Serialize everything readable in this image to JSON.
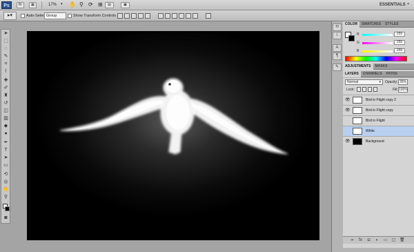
{
  "appbar": {
    "logo": "Ps",
    "zoom": "17%",
    "workspace": "ESSENTIALS"
  },
  "options": {
    "auto_select_label": "Auto-Select:",
    "auto_select_value": "Group",
    "show_transform_label": "Show Transform Controls"
  },
  "color_panel": {
    "tabs": [
      "COLOR",
      "SWATCHES",
      "STYLES"
    ],
    "channels": [
      {
        "name": "R",
        "value": "255"
      },
      {
        "name": "G",
        "value": "255"
      },
      {
        "name": "B",
        "value": "255"
      }
    ]
  },
  "adjustments_panel": {
    "tabs": [
      "ADJUSTMENTS",
      "MASKS"
    ]
  },
  "layers_panel": {
    "tabs": [
      "LAYERS",
      "CHANNELS",
      "PATHS"
    ],
    "blend_mode": "Normal",
    "opacity_label": "Opacity:",
    "opacity_value": "26%",
    "lock_label": "Lock:",
    "fill_label": "Fill:",
    "fill_value": "100%",
    "layers": [
      {
        "name": "Bird in Flight copy 2",
        "visible": true,
        "thumb": "bird",
        "selected": false
      },
      {
        "name": "Bird in Flight copy",
        "visible": true,
        "thumb": "bird",
        "selected": false
      },
      {
        "name": "Bird in Flight",
        "visible": false,
        "thumb": "bird",
        "selected": false
      },
      {
        "name": "White",
        "visible": false,
        "thumb": "white",
        "selected": true
      },
      {
        "name": "Background",
        "visible": true,
        "thumb": "black",
        "selected": false
      }
    ]
  }
}
